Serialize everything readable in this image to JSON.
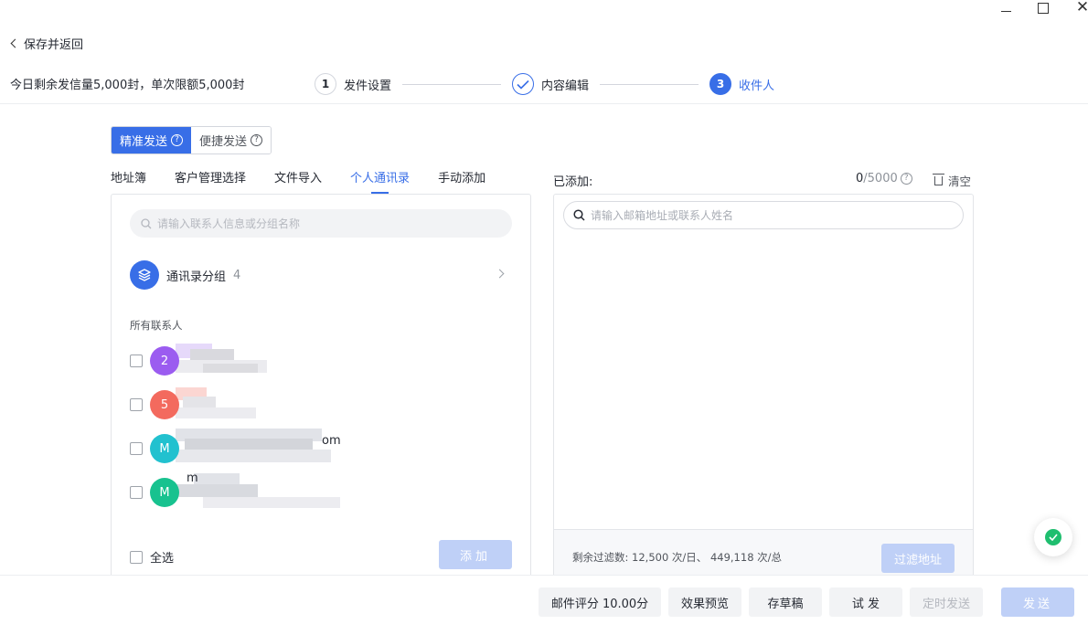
{
  "window": {
    "close_glyph": "✕"
  },
  "header": {
    "back_label": "保存并返回",
    "quota_text": "今日剩余发信量5,000封，单次限额5,000封"
  },
  "steps": [
    {
      "num": "1",
      "label": "发件设置",
      "state": "default"
    },
    {
      "num": "",
      "label": "内容编辑",
      "state": "done"
    },
    {
      "num": "3",
      "label": "收件人",
      "state": "active"
    }
  ],
  "mode": {
    "precise": "精准发送",
    "quick": "便捷发送",
    "selected": "精准发送"
  },
  "tabs": [
    "地址簿",
    "客户管理选择",
    "文件导入",
    "个人通讯录",
    "手动添加"
  ],
  "active_tab": "个人通讯录",
  "left": {
    "search_placeholder": "请输入联系人信息或分组名称",
    "group_label": "通讯录分组",
    "group_count": "4",
    "all_contacts_label": "所有联系人",
    "contacts": [
      {
        "avatar": "2",
        "color": "#9b5cf0",
        "visible_text": ""
      },
      {
        "avatar": "5",
        "color": "#f36a5e",
        "visible_text": ""
      },
      {
        "avatar": "M",
        "color": "#22c1cf",
        "visible_text": "om"
      },
      {
        "avatar": "M",
        "color": "#18c28f",
        "visible_text": "m"
      }
    ],
    "select_all_label": "全选",
    "add_button": "添加"
  },
  "right": {
    "added_label": "已添加:",
    "added_current": "0",
    "added_max": "/5000",
    "clear_label": "清空",
    "search_placeholder": "请输入邮箱地址或联系人姓名",
    "filter_quota_text": "剩余过滤数: 12,500 次/日、 449,118 次/总",
    "filter_button": "过滤地址"
  },
  "footer": {
    "score_button": "邮件评分 10.00分",
    "preview_button": "效果预览",
    "draft_button": "存草稿",
    "test_button": "试 发",
    "schedule_button": "定时发送",
    "send_button": "发送"
  },
  "colors": {
    "accent": "#386ee7",
    "disabled_primary": "#bfd0f7",
    "success": "#1fbe6f"
  }
}
